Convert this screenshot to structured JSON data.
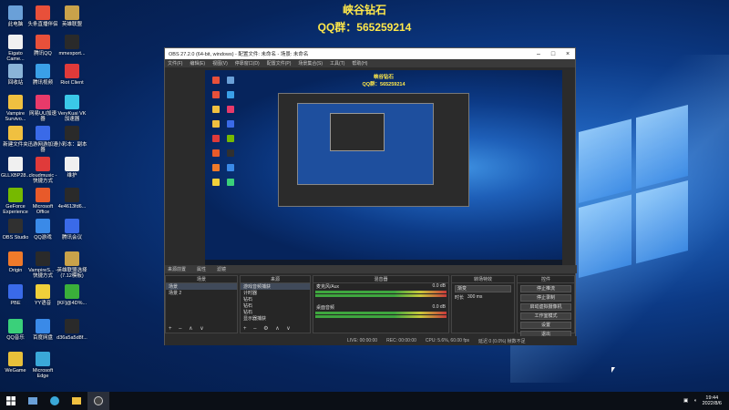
{
  "overlay": {
    "line1": "峡谷钻石",
    "line2": "QQ群：565259214"
  },
  "desktop_icons": [
    {
      "label": "此电脑",
      "color": "#6aa0d8"
    },
    {
      "label": "头条直播伴侣",
      "color": "#e8503a"
    },
    {
      "label": "英雄联盟",
      "color": "#c9a24a"
    },
    {
      "label": "Eigato Came...",
      "color": "#f0f0f0"
    },
    {
      "label": "腾讯QQ",
      "color": "#e8503a"
    },
    {
      "label": "mmexport...",
      "color": "#2a2a2a"
    },
    {
      "label": "回收站",
      "color": "#8ab4d8"
    },
    {
      "label": "腾讯视频",
      "color": "#3aa0e8"
    },
    {
      "label": "Riot Client",
      "color": "#e03a3a"
    },
    {
      "label": "Vampire Survivo...",
      "color": "#f0c040"
    },
    {
      "label": "网易UU加速器",
      "color": "#e83a6a"
    },
    {
      "label": "VeryKuai VK加速器",
      "color": "#3ac8e8"
    },
    {
      "label": "新建文件夹",
      "color": "#f0c040"
    },
    {
      "label": "迅游网游加速器",
      "color": "#3a6ae8"
    },
    {
      "label": "小彩本：副本",
      "color": "#2a2a2a"
    },
    {
      "label": "GLLXBP28...",
      "color": "#f0f0f0"
    },
    {
      "label": "cloudmusic - 快捷方式",
      "color": "#e03a3a"
    },
    {
      "label": "维护",
      "color": "#f0f0f0"
    },
    {
      "label": "GeForce Experience",
      "color": "#76b900"
    },
    {
      "label": "Microsoft Office",
      "color": "#e85a2a"
    },
    {
      "label": "4e4613fd6...",
      "color": "#2a2a2a"
    },
    {
      "label": "OBS Studio",
      "color": "#303030"
    },
    {
      "label": "QQ游戏",
      "color": "#3a8ae8"
    },
    {
      "label": "腾讯会议",
      "color": "#3a6ae8"
    },
    {
      "label": "Origin",
      "color": "#f07a2a"
    },
    {
      "label": "VampireS... - 快捷方式",
      "color": "#2a2a2a"
    },
    {
      "label": "英雄联盟选择 (7.12模板)",
      "color": "#c9a24a"
    },
    {
      "label": "PBE",
      "color": "#3a6ae8"
    },
    {
      "label": "YY语音",
      "color": "#f0d03a"
    },
    {
      "label": "[KF]@4D%...",
      "color": "#3ab03a"
    },
    {
      "label": "QQ音乐",
      "color": "#3ad07a"
    },
    {
      "label": "百度网盘",
      "color": "#3a8ae8"
    },
    {
      "label": "d36a5a5d8f...",
      "color": "#2a2a2a"
    },
    {
      "label": "WeGame",
      "color": "#e8c03a"
    },
    {
      "label": "Microsoft Edge",
      "color": "#3aa8d8"
    }
  ],
  "obs": {
    "title": "OBS 27.2.0 (64-bit, windows) - 配置文件: 未命名 - 场景: 未命名",
    "menu": [
      "文件(F)",
      "编辑(E)",
      "视图(V)",
      "停靠窗口(D)",
      "配置文件(P)",
      "场景集合(S)",
      "工具(T)",
      "帮助(H)"
    ],
    "preview_overlay": {
      "line1": "峡谷钻石",
      "line2": "QQ群：565259214"
    },
    "dock_header": [
      "来源前置",
      "属性",
      "滤镜"
    ],
    "scenes": {
      "title": "场景",
      "items": [
        "场景",
        "场景 2"
      ]
    },
    "sources": {
      "title": "来源",
      "items": [
        "游戏音频捕获",
        "计时器",
        "钻石",
        "钻石",
        "钻石",
        "显示器捕获"
      ]
    },
    "mixer": {
      "title": "混音器",
      "ch1": "麦克风/Aux",
      "ch1_db": "0.0 dB",
      "ch2": "桌面音频",
      "ch2_db": "0.0 dB"
    },
    "transitions": {
      "title": "转场特效",
      "type": "渐变",
      "duration_label": "时长",
      "duration": "300 ms"
    },
    "controls": {
      "title": "控件",
      "buttons": [
        "停止推流",
        "停止录制",
        "启动虚拟摄像机",
        "工作室模式",
        "设置",
        "退出"
      ]
    },
    "status": {
      "live": "LIVE: 00:00:00",
      "rec": "REC: 00:00:00",
      "cpu": "CPU: 5.6%, 60.00 fps",
      "kbps": "延迟 0 (0.0%) 帧数不足"
    }
  },
  "taskbar": {
    "time": "19:44",
    "date": "2022/8/6"
  }
}
